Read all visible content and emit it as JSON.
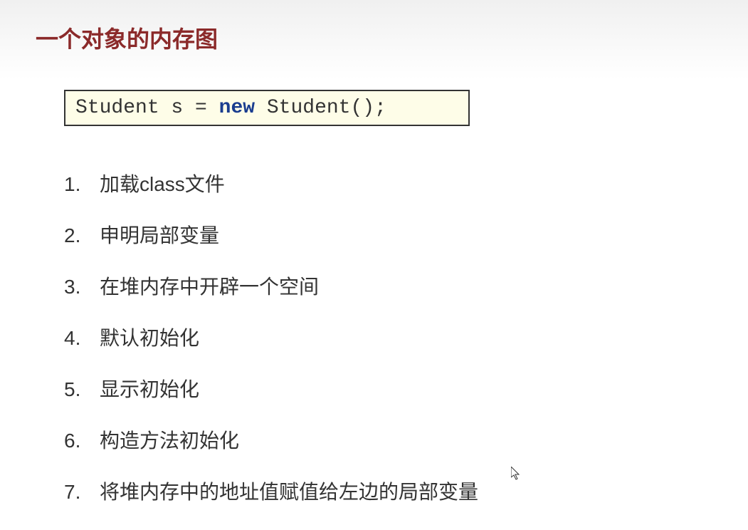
{
  "title": "一个对象的内存图",
  "code": {
    "part1": "Student s = ",
    "keyword": "new",
    "part2": " Student();"
  },
  "list": [
    {
      "num": "1.",
      "text": "加载class文件"
    },
    {
      "num": "2.",
      "text": "申明局部变量"
    },
    {
      "num": "3.",
      "text": "在堆内存中开辟一个空间"
    },
    {
      "num": "4.",
      "text": "默认初始化"
    },
    {
      "num": "5.",
      "text": "显示初始化"
    },
    {
      "num": "6.",
      "text": "构造方法初始化"
    },
    {
      "num": "7.",
      "text": "将堆内存中的地址值赋值给左边的局部变量"
    }
  ]
}
